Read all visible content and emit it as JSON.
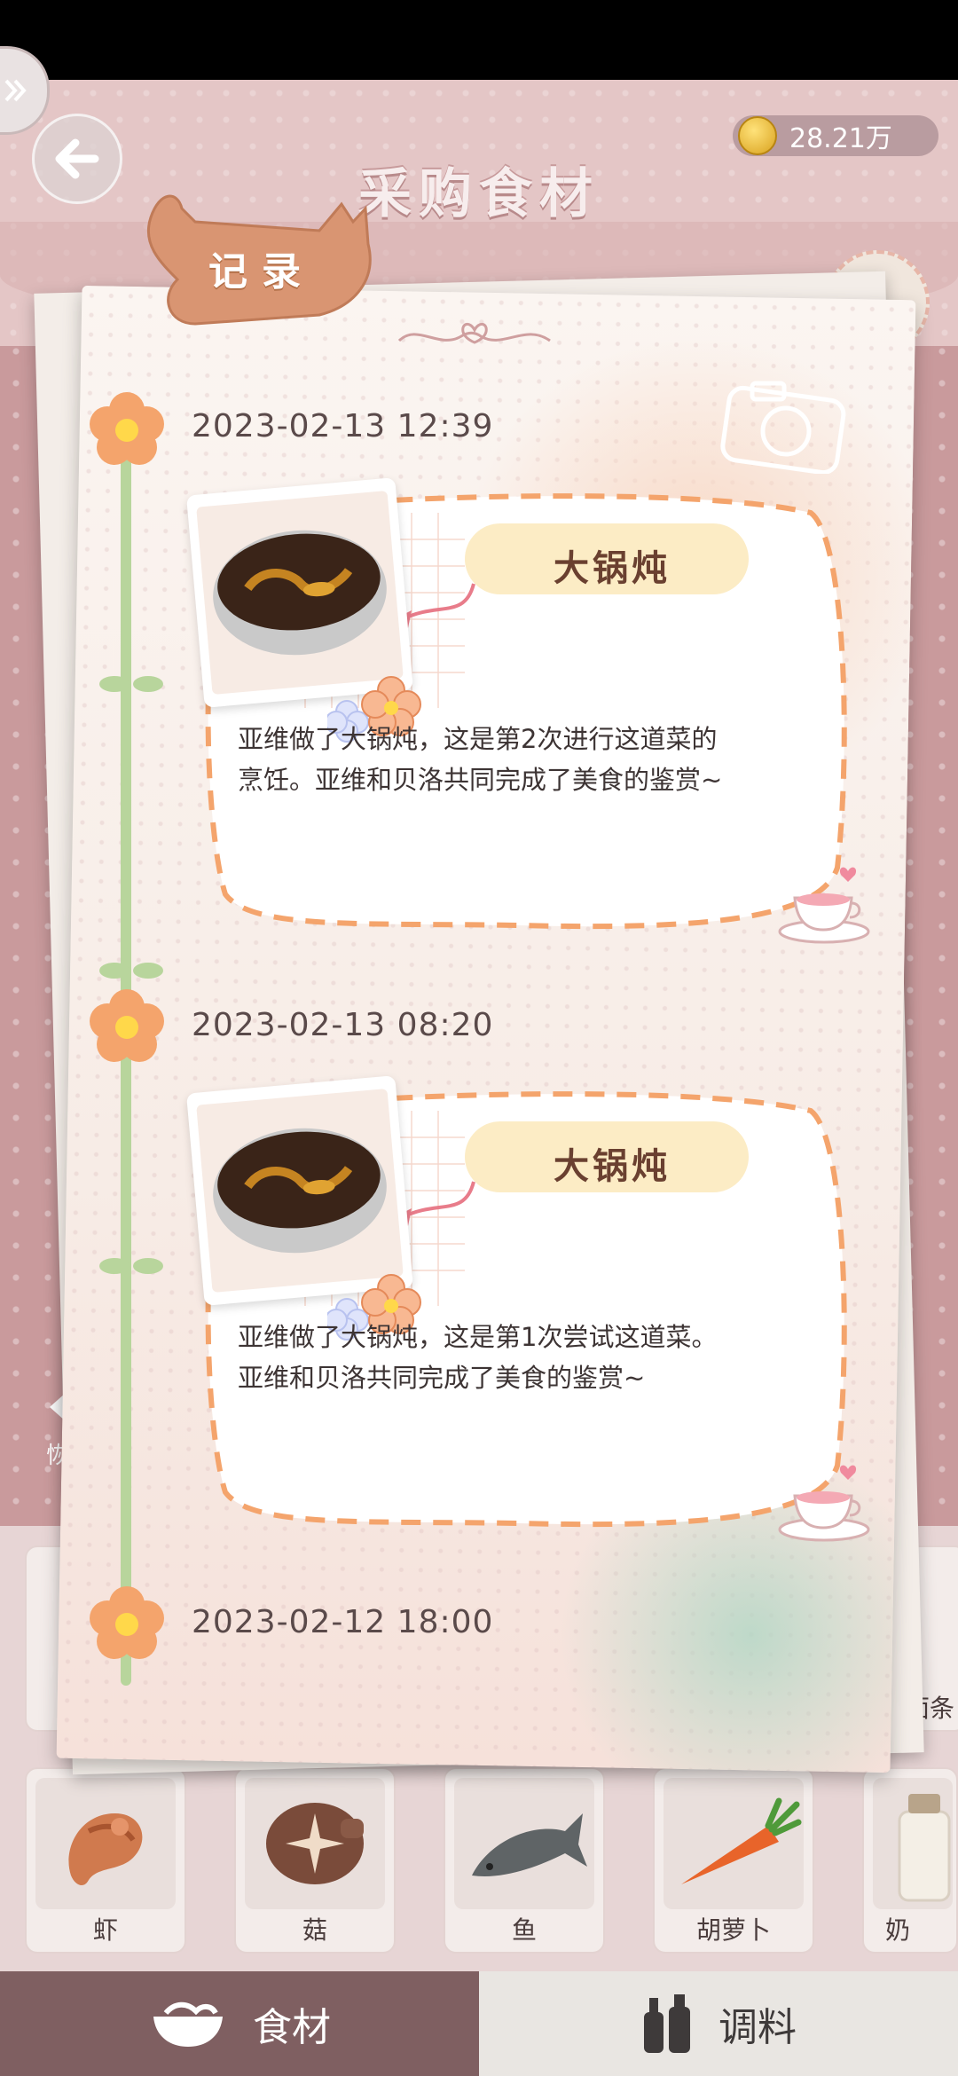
{
  "header": {
    "title": "采购食材",
    "coins": "28.21万"
  },
  "record": {
    "tab_label": "记录",
    "entries": [
      {
        "timestamp": "2023-02-13 12:39",
        "dish": "大锅炖",
        "text_line1": "亚维做了大锅炖，这是第2次进行这道菜的",
        "text_line2": "烹饪。亚维和贝洛共同完成了美食的鉴赏~"
      },
      {
        "timestamp": "2023-02-13 08:20",
        "dish": "大锅炖",
        "text_line1": "亚维做了大锅炖，这是第1次尝试这道菜。",
        "text_line2": "亚维和贝洛共同完成了美食的鉴赏~"
      },
      {
        "timestamp": "2023-02-12 18:00"
      }
    ]
  },
  "side_hints": {
    "left_partial": "恢",
    "right_partial": "面条"
  },
  "ingredients_row": [
    {
      "label": "虾",
      "icon": "shrimp-icon"
    },
    {
      "label": "菇",
      "icon": "mushroom-icon"
    },
    {
      "label": "鱼",
      "icon": "fish-icon"
    },
    {
      "label": "胡萝卜",
      "icon": "carrot-icon"
    },
    {
      "label": "奶",
      "icon": "milk-icon"
    }
  ],
  "tabs": [
    {
      "label": "食材",
      "icon": "bowl-icon",
      "active": true
    },
    {
      "label": "调料",
      "icon": "bottles-icon",
      "active": false
    }
  ],
  "colors": {
    "accent_pink": "#c99a9c",
    "timeline_green": "#b8d59c",
    "flower_orange": "#f4a46c",
    "cat_tan": "#d99572"
  }
}
